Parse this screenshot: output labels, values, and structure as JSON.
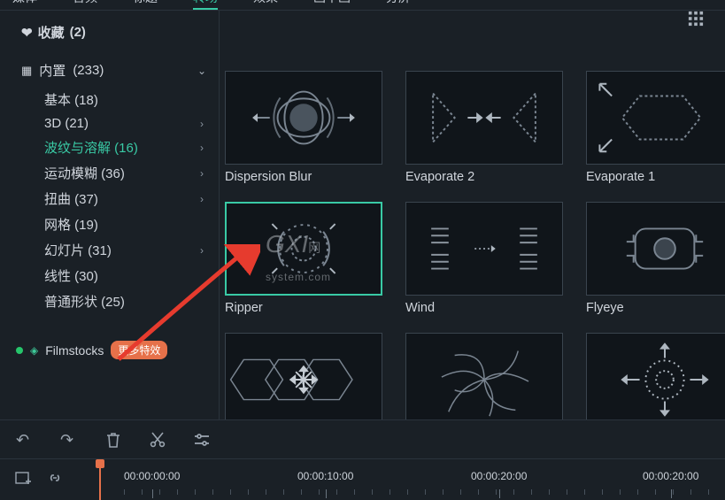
{
  "tabs": {
    "items": [
      "媒体",
      "音频",
      "标题",
      "转场",
      "效果",
      "画中画",
      "分屏"
    ],
    "active": "转场"
  },
  "sidebar": {
    "favorites": {
      "label": "收藏",
      "count": "(2)"
    },
    "root": {
      "label": "内置",
      "count": "(233)"
    },
    "cats": [
      {
        "label": "基本",
        "count": "(18)",
        "chev": false
      },
      {
        "label": "3D",
        "count": "(21)",
        "chev": true
      },
      {
        "label": "波纹与溶解",
        "count": "(16)",
        "chev": true,
        "selected": true
      },
      {
        "label": "运动模糊",
        "count": "(36)",
        "chev": true
      },
      {
        "label": "扭曲",
        "count": "(37)",
        "chev": true
      },
      {
        "label": "网格",
        "count": "(19)",
        "chev": false
      },
      {
        "label": "幻灯片",
        "count": "(31)",
        "chev": true
      },
      {
        "label": "线性",
        "count": "(30)",
        "chev": false
      },
      {
        "label": "普通形状",
        "count": "(25)",
        "chev": false
      }
    ],
    "filmstocks": {
      "label": "Filmstocks",
      "badge": "更多特效"
    }
  },
  "effects": [
    {
      "name": "Dispersion Blur",
      "icon": "dispersion",
      "selected": false
    },
    {
      "name": "Evaporate 2",
      "icon": "evap2",
      "selected": false
    },
    {
      "name": "Evaporate 1",
      "icon": "evap1",
      "selected": false
    },
    {
      "name": "Ripper",
      "icon": "ripper",
      "selected": true
    },
    {
      "name": "Wind",
      "icon": "wind",
      "selected": false
    },
    {
      "name": "Flyeye",
      "icon": "flyeye",
      "selected": false
    },
    {
      "name": "",
      "icon": "hex",
      "selected": false
    },
    {
      "name": "",
      "icon": "spiral",
      "selected": false
    },
    {
      "name": "",
      "icon": "spread",
      "selected": false
    }
  ],
  "timeline": {
    "ticks": [
      "00:00:00:00",
      "00:00:10:00",
      "00:00:20:00",
      "00:00:20:00"
    ]
  },
  "watermark": {
    "big": "GXI",
    "sub": "网",
    "url": "system.com"
  }
}
